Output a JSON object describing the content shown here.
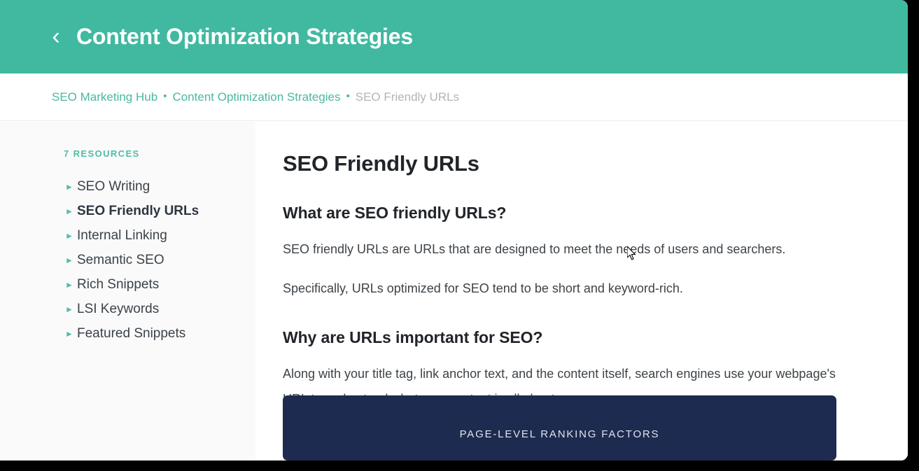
{
  "header": {
    "title": "Content Optimization Strategies",
    "back_icon": "‹",
    "background_color": "#40B9A0"
  },
  "breadcrumb": {
    "separator": "•",
    "items": [
      {
        "label": "SEO Marketing Hub",
        "current": false
      },
      {
        "label": "Content Optimization Strategies",
        "current": false
      },
      {
        "label": "SEO Friendly URLs",
        "current": true
      }
    ]
  },
  "sidebar": {
    "count_label": "7 RESOURCES",
    "bullet_icon": "►",
    "accent_color": "#4fbda6",
    "items": [
      {
        "label": "SEO Writing",
        "active": false
      },
      {
        "label": "SEO Friendly URLs",
        "active": true
      },
      {
        "label": "Internal Linking",
        "active": false
      },
      {
        "label": "Semantic SEO",
        "active": false
      },
      {
        "label": "Rich Snippets",
        "active": false
      },
      {
        "label": "LSI Keywords",
        "active": false
      },
      {
        "label": "Featured Snippets",
        "active": false
      }
    ]
  },
  "main": {
    "page_title": "SEO Friendly URLs",
    "section_one": {
      "heading": "What are SEO friendly URLs?",
      "paragraph_one": "SEO friendly URLs are URLs that are designed to meet the needs of users and searchers.",
      "paragraph_two": "Specifically, URLs optimized for SEO tend to be short and keyword-rich."
    },
    "section_two": {
      "heading": "Why are URLs important for SEO?",
      "paragraph": "Along with your title tag, link anchor text, and the content itself, search engines use your webpage's URL to understand what your content is all about."
    },
    "card": {
      "title": "PAGE-LEVEL RANKING FACTORS",
      "background_color": "#1d2b50"
    }
  }
}
